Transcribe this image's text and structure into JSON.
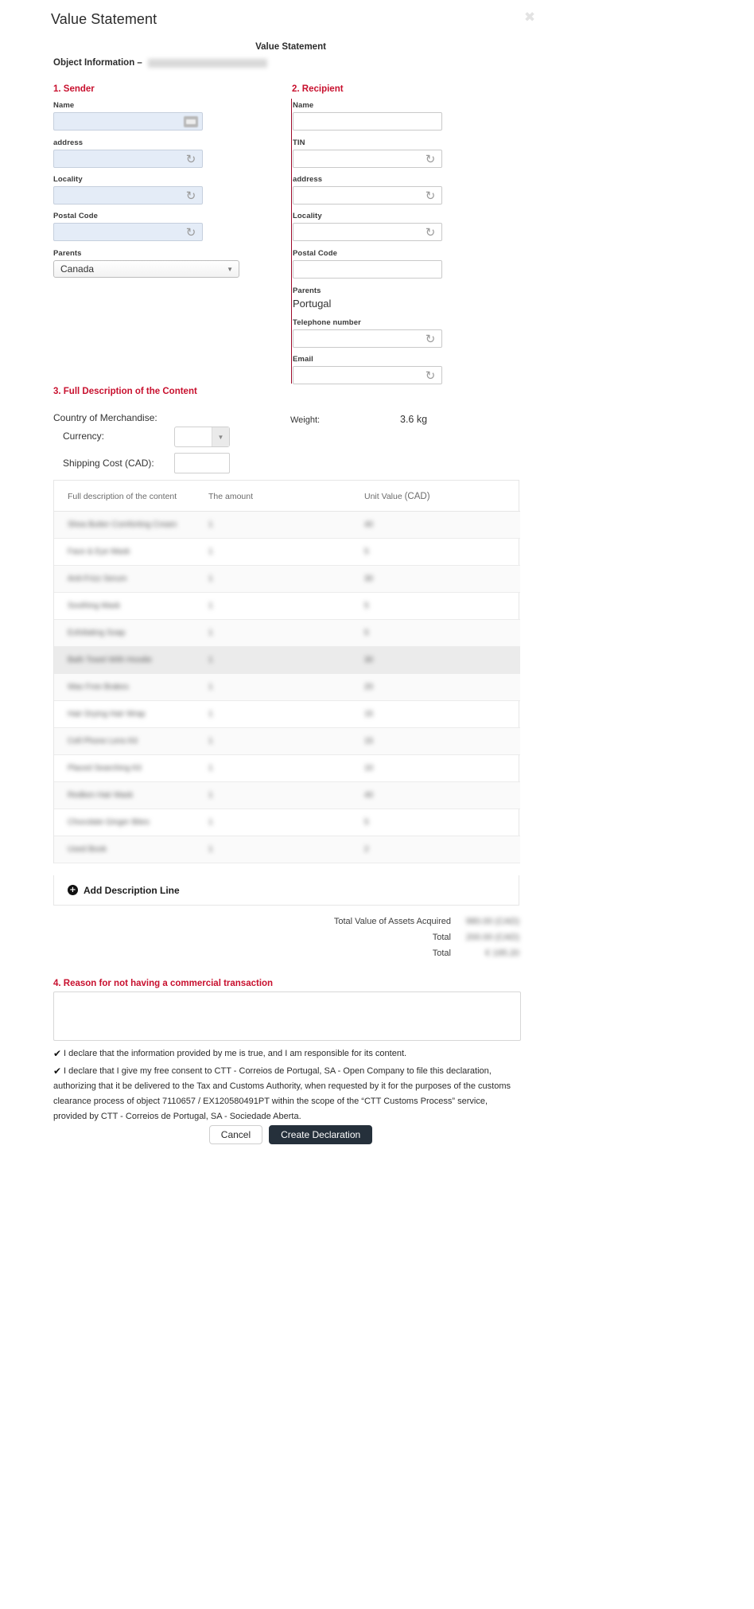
{
  "modal": {
    "title": "Value Statement",
    "close_icon": "close-icon",
    "document_subtitle": "Value Statement",
    "object_information_label": "Object Information –",
    "object_information_value": "7110657 / EX120580491PT"
  },
  "sender": {
    "heading": "1. Sender",
    "fields": [
      {
        "label": "Name",
        "value": "",
        "placeholder": "",
        "icon": "keyboard-icon"
      },
      {
        "label": "address",
        "value": "",
        "placeholder": "",
        "icon": "revert-icon"
      },
      {
        "label": "Locality",
        "value": "",
        "placeholder": "",
        "icon": "revert-icon"
      },
      {
        "label": "Postal Code",
        "value": "",
        "placeholder": "",
        "icon": "revert-icon"
      }
    ],
    "country_label": "Parents",
    "country_value": "Canada"
  },
  "recipient": {
    "heading": "2. Recipient",
    "fields": [
      {
        "label": "Name",
        "value": "",
        "placeholder": "",
        "icon": ""
      },
      {
        "label": "TIN",
        "value": "",
        "placeholder": "",
        "icon": "revert-icon"
      },
      {
        "label": "address",
        "value": "",
        "placeholder": "",
        "icon": "revert-icon"
      },
      {
        "label": "Locality",
        "value": "",
        "placeholder": "",
        "icon": "revert-icon"
      },
      {
        "label": "Postal Code",
        "value": "",
        "placeholder": "",
        "icon": ""
      }
    ],
    "country_label": "Parents",
    "country_value": "Portugal",
    "phone_label": "Telephone number",
    "phone_value": "",
    "email_label": "Email",
    "email_value": ""
  },
  "content": {
    "heading": "3. Full Description of the Content",
    "country_of_merchandise_label": "Country of Merchandise:",
    "currency_label": "Currency:",
    "currency_value": "",
    "shipping_cost_label": "Shipping Cost (CAD):",
    "shipping_cost_value": "",
    "weight_label": "Weight:",
    "weight_value": "3.6 kg"
  },
  "table": {
    "columns": [
      "Full description of the content",
      "The amount",
      "Unit Value",
      "(CAD)"
    ],
    "rows": [
      {
        "description": "Shea Butter Comforting Cream",
        "amount": "1",
        "unit_value": "40"
      },
      {
        "description": "Face & Eye Mask",
        "amount": "1",
        "unit_value": "5"
      },
      {
        "description": "Anti-Frizz Serum",
        "amount": "1",
        "unit_value": "30"
      },
      {
        "description": "Soothing Mask",
        "amount": "1",
        "unit_value": "5"
      },
      {
        "description": "Exfoliating Soap",
        "amount": "1",
        "unit_value": "5"
      },
      {
        "description": "Bath Towel With Hoodie",
        "amount": "1",
        "unit_value": "30"
      },
      {
        "description": "Wax Free Brakes",
        "amount": "1",
        "unit_value": "20"
      },
      {
        "description": "Hair Drying Hair Wrap",
        "amount": "1",
        "unit_value": "15"
      },
      {
        "description": "Cell Phone Lens Kit",
        "amount": "1",
        "unit_value": "15"
      },
      {
        "description": "Placed Searching Kit",
        "amount": "1",
        "unit_value": "10"
      },
      {
        "description": "Redken Hair Mask",
        "amount": "1",
        "unit_value": "40"
      },
      {
        "description": "Chocolate Ginger Bites",
        "amount": "1",
        "unit_value": "5"
      },
      {
        "description": "Used Book",
        "amount": "1",
        "unit_value": "2"
      }
    ],
    "add_line_label": "Add Description Line",
    "add_line_icon": "plus-circle-icon"
  },
  "totals": [
    {
      "label": "Total Value of Assets Acquired",
      "value": "980.00 (CAD)"
    },
    {
      "label": "Total",
      "value": "200.00 (CAD)"
    },
    {
      "label": "Total",
      "value": "€ 195.20"
    }
  ],
  "reason": {
    "heading": "4. Reason for not having a commercial transaction",
    "value": "",
    "placeholder": ""
  },
  "declarations": [
    {
      "checked": true,
      "text": "I declare that the information provided by me is true, and I am responsible for its content."
    },
    {
      "checked": true,
      "text": "I declare that I give my free consent to CTT - Correios de Portugal, SA - Open Company to file this declaration, authorizing that it be delivered to the Tax and Customs Authority, when requested by it for the purposes of the customs clearance process of object 7110657 / EX120580491PT  within the scope of the “CTT Customs Process” service, provided by CTT - Correios de Portugal, SA - Sociedade Aberta."
    }
  ],
  "actions": {
    "cancel_label": "Cancel",
    "create_label": "Create Declaration"
  },
  "colors": {
    "accent_red": "#c8102e",
    "primary_button": "#25303b",
    "sender_field_bg": "#e4ecf7"
  }
}
